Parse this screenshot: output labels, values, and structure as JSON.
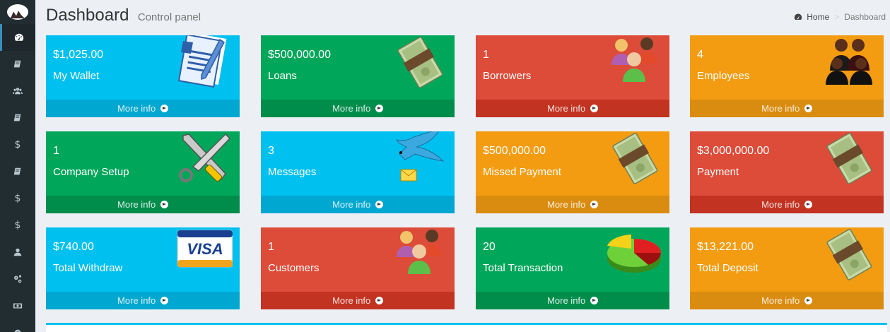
{
  "header": {
    "title": "Dashboard",
    "subtitle": "Control panel"
  },
  "breadcrumb": {
    "home": "Home",
    "current": "Dashboard",
    "icon": "dashboard-icon"
  },
  "sidebar": {
    "items": [
      {
        "icon": "dashboard-icon",
        "active": true
      },
      {
        "icon": "book-icon"
      },
      {
        "icon": "users-icon"
      },
      {
        "icon": "book-icon"
      },
      {
        "icon": "dollar-icon"
      },
      {
        "icon": "book-icon"
      },
      {
        "icon": "dollar-icon"
      },
      {
        "icon": "dollar-icon"
      },
      {
        "icon": "user-icon"
      },
      {
        "icon": "cogs-icon"
      },
      {
        "icon": "money-icon"
      },
      {
        "icon": "gear-icon"
      }
    ]
  },
  "colors": {
    "aqua": "#00c0ef",
    "green": "#00a65a",
    "red": "#dd4b39",
    "orange": "#f39c12",
    "sidebar": "#222d32"
  },
  "boxes": [
    {
      "value": "$1,025.00",
      "label": "My Wallet",
      "more": "More info",
      "icon": "document-pen-icon",
      "color": "aqua"
    },
    {
      "value": "$500,000.00",
      "label": "Loans",
      "more": "More info",
      "icon": "money-stack-icon",
      "color": "green"
    },
    {
      "value": "1",
      "label": "Borrowers",
      "more": "More info",
      "icon": "people-icon",
      "color": "red"
    },
    {
      "value": "4",
      "label": "Employees",
      "more": "More info",
      "icon": "employees-icon",
      "color": "orange"
    },
    {
      "value": "1",
      "label": "Company Setup",
      "more": "More info",
      "icon": "tools-icon",
      "color": "green"
    },
    {
      "value": "3",
      "label": "Messages",
      "more": "More info",
      "icon": "bird-mail-icon",
      "color": "aqua"
    },
    {
      "value": "$500,000.00",
      "label": "Missed Payment",
      "more": "More info",
      "icon": "money-stack-icon",
      "color": "orange"
    },
    {
      "value": "$3,000,000.00",
      "label": "Payment",
      "more": "More info",
      "icon": "money-stack-icon",
      "color": "red"
    },
    {
      "value": "$740.00",
      "label": "Total Withdraw",
      "more": "More info",
      "icon": "visa-card-icon",
      "color": "aqua"
    },
    {
      "value": "1",
      "label": "Customers",
      "more": "More info",
      "icon": "people-icon",
      "color": "red"
    },
    {
      "value": "20",
      "label": "Total Transaction",
      "more": "More info",
      "icon": "pie-chart-icon",
      "color": "green"
    },
    {
      "value": "$13,221.00",
      "label": "Total Deposit",
      "more": "More info",
      "icon": "money-stack-icon",
      "color": "orange"
    }
  ]
}
